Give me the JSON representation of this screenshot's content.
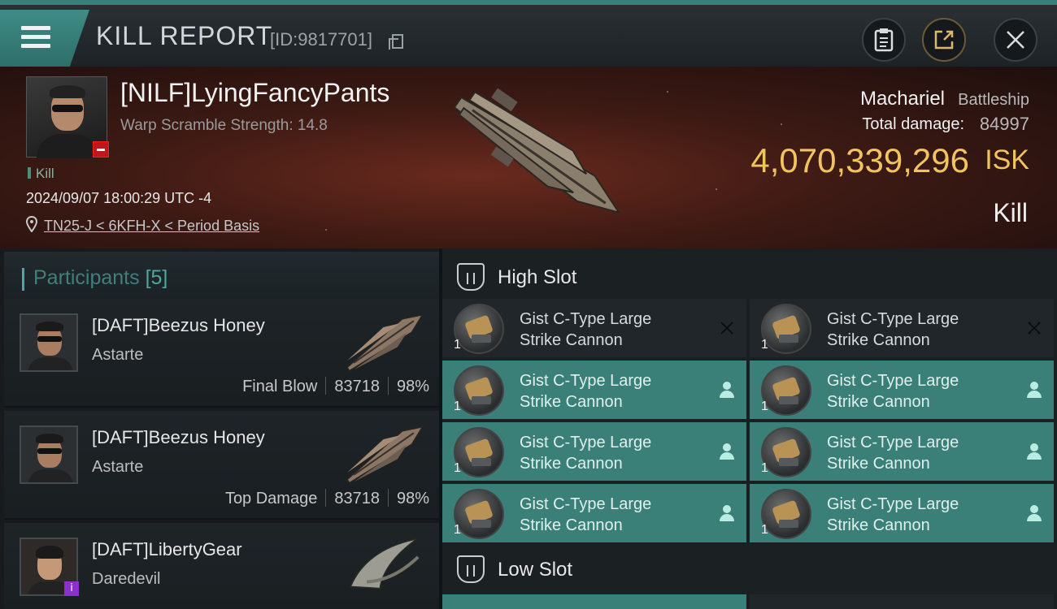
{
  "header": {
    "title": "KILL REPORT",
    "id_text": "[ID:9817701]"
  },
  "victim": {
    "name": "[NILF]LyingFancyPants",
    "scramble": "Warp Scramble Strength: 14.8",
    "tag": "Kill",
    "timestamp": "2024/09/07 18:00:29 UTC -4",
    "location": "TN25-J < 6KFH-X < Period Basis",
    "ship_name": "Machariel",
    "ship_class": "Battleship",
    "total_damage_label": "Total damage:",
    "total_damage": "84997",
    "isk_value": "4,070,339,296",
    "isk_unit": "ISK",
    "result": "Kill"
  },
  "participants": {
    "title": "Participants",
    "count": "[5]",
    "rows": [
      {
        "name": "[DAFT]Beezus Honey",
        "ship": "Astarte",
        "role": "Final Blow",
        "damage": "83718",
        "percent": "98%"
      },
      {
        "name": "[DAFT]Beezus Honey",
        "ship": "Astarte",
        "role": "Top Damage",
        "damage": "83718",
        "percent": "98%"
      },
      {
        "name": "[DAFT]LibertyGear",
        "ship": "Daredevil",
        "role": "",
        "damage": "",
        "percent": ""
      }
    ]
  },
  "fitting": {
    "high_slot_title": "High Slot",
    "low_slot_title": "Low Slot",
    "high_modules": [
      {
        "line1": "Gist C-Type Large",
        "line2": "Strike Cannon",
        "qty": "1",
        "status": "destroyed"
      },
      {
        "line1": "Gist C-Type Large",
        "line2": "Strike Cannon",
        "qty": "1",
        "status": "destroyed"
      },
      {
        "line1": "Gist C-Type Large",
        "line2": "Strike Cannon",
        "qty": "1",
        "status": "dropped"
      },
      {
        "line1": "Gist C-Type Large",
        "line2": "Strike Cannon",
        "qty": "1",
        "status": "dropped"
      },
      {
        "line1": "Gist C-Type Large",
        "line2": "Strike Cannon",
        "qty": "1",
        "status": "dropped"
      },
      {
        "line1": "Gist C-Type Large",
        "line2": "Strike Cannon",
        "qty": "1",
        "status": "dropped"
      },
      {
        "line1": "Gist C-Type Large",
        "line2": "Strike Cannon",
        "qty": "1",
        "status": "dropped"
      },
      {
        "line1": "Gist C-Type Large",
        "line2": "Strike Cannon",
        "qty": "1",
        "status": "dropped"
      }
    ]
  },
  "colors": {
    "accent_teal": "#3a7f78",
    "isk_gold": "#f2c45f",
    "loss_red": "#c0171a"
  },
  "icons": [
    "menu-icon",
    "copy-icon",
    "clipboard-icon",
    "share-icon",
    "close-icon",
    "location-pin-icon",
    "high-slot-icon",
    "low-slot-icon",
    "destroyed-x-icon",
    "dropped-person-icon"
  ]
}
